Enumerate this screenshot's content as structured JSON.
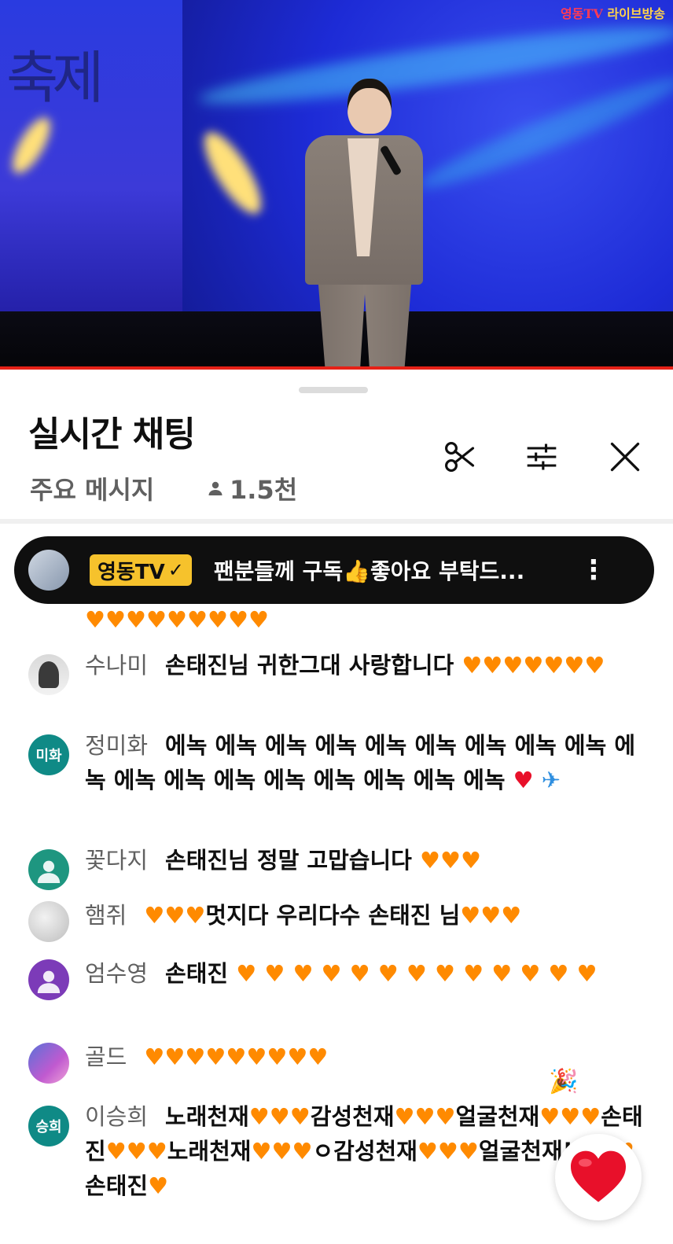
{
  "video": {
    "watermark_a": "영동TV",
    "watermark_b": "라이브방송",
    "banner_text": "축제"
  },
  "chat_panel": {
    "title": "실시간 채팅",
    "mode": "주요 메시지",
    "viewer_count": "1.5천",
    "icons": [
      "scissors-icon",
      "sliders-icon",
      "close-icon"
    ]
  },
  "pinned": {
    "channel": "영동TV",
    "message": "팬분들께 구독👍좋아요 부탁드..."
  },
  "messages": [
    {
      "author": "",
      "text": "🧡🧡🧡🧡🧡🧡🧡🧡🧡"
    },
    {
      "author": "수나미",
      "text": "손태진님 귀한그대 사랑합니다 🧡🧡🧡🧡🧡🧡🧡"
    },
    {
      "author": "정미화",
      "avatar_label": "미화",
      "text": "에녹 에녹 에녹 에녹 에녹 에녹 에녹 에녹 에녹 에녹 에녹 에녹 에녹 에녹 에녹 에녹 에녹 에녹 ❤️ ✈️"
    },
    {
      "author": "꽃다지",
      "text": "손태진님 정말 고맙습니다 🧡🧡🧡"
    },
    {
      "author": "햄쥐",
      "text": "🧡🧡🧡멋지다 우리다수 손태진 님🧡🧡🧡"
    },
    {
      "author": "엄수영",
      "text": "손태진 🧡 🧡 🧡 🧡 🧡 🧡 🧡 🧡 🧡 🧡 🧡 🧡 🧡"
    },
    {
      "author": "골드",
      "text": "🧡🧡🧡🧡🧡🧡🧡🧡🧡"
    },
    {
      "author": "이승희",
      "avatar_label": "승희",
      "text": "노래천재🧡🧡🧡감성천재🧡🧡🧡얼굴천재🧡🧡🧡손태진🧡🧡🧡노래천재🧡🧡🧡ㅇ감성천재🧡🧡🧡얼굴천재!🧡🧡🧡손태진🧡"
    }
  ],
  "like_button": {
    "icon": "heart-icon"
  },
  "colors": {
    "accent_orange": "#ff8a00",
    "heart_red": "#e8102a",
    "badge_yellow": "#f6c22c",
    "progress_red": "#e62117"
  }
}
